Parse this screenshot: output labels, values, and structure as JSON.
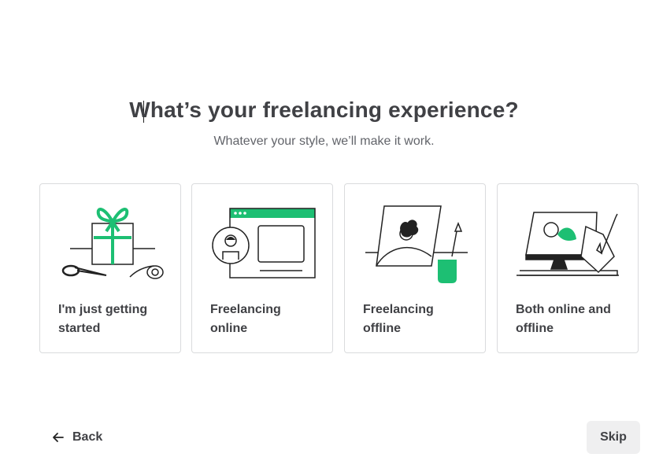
{
  "heading": "What’s your freelancing experience?",
  "subheading": "Whatever your style, we’ll make it work.",
  "options": [
    {
      "label": "I'm just getting started",
      "icon": "gift-icon"
    },
    {
      "label": "Freelancing online",
      "icon": "online-profile-icon"
    },
    {
      "label": "Freelancing offline",
      "icon": "easel-painting-icon"
    },
    {
      "label": "Both online and offline",
      "icon": "monitor-and-sketch-icon"
    }
  ],
  "nav": {
    "back_label": "Back",
    "skip_label": "Skip"
  },
  "colors": {
    "accent": "#1dbf73",
    "text": "#404145",
    "muted": "#62646a",
    "card_border": "#dadbdd",
    "skip_bg": "#efeff0"
  }
}
